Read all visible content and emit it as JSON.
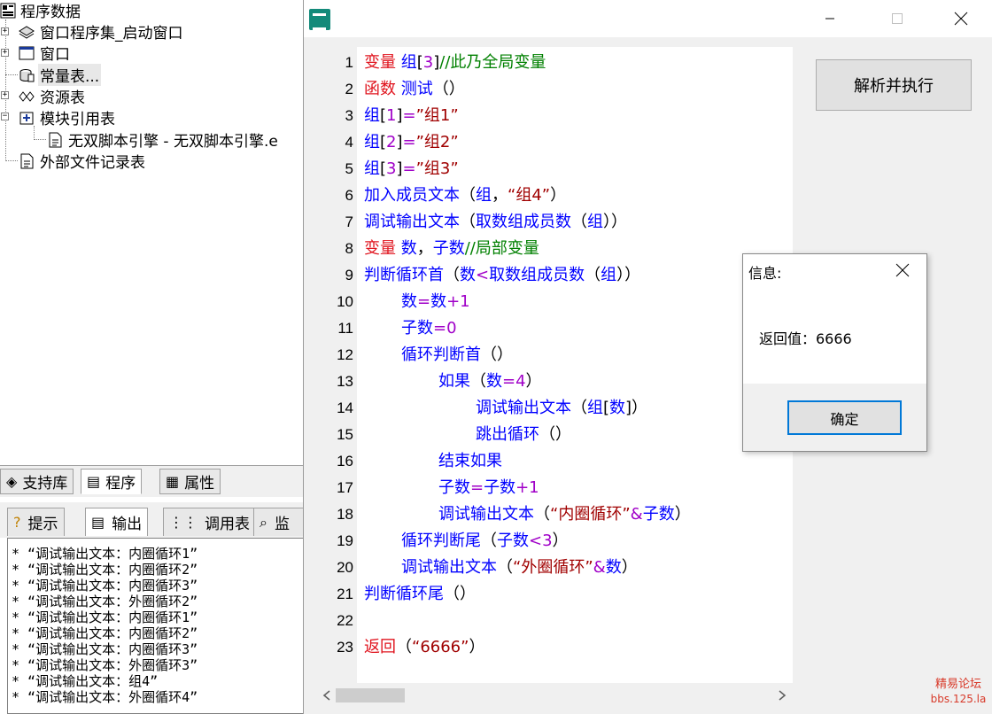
{
  "tree": {
    "root": "程序数据",
    "items": [
      {
        "label": "窗口程序集_启动窗口",
        "icon": "assembly-icon"
      },
      {
        "label": "窗口",
        "icon": "window-icon"
      },
      {
        "label": "常量表...",
        "icon": "constant-table-icon"
      },
      {
        "label": "资源表",
        "icon": "resource-icon"
      },
      {
        "label": "模块引用表",
        "icon": "module-ref-icon"
      },
      {
        "label": "无双脚本引擎 - 无双脚本引擎.e",
        "icon": "document-icon"
      },
      {
        "label": "外部文件记录表",
        "icon": "document-icon"
      }
    ]
  },
  "lower_tabs": [
    {
      "label": "支持库",
      "icon": "library-icon"
    },
    {
      "label": "程序",
      "icon": "program-icon"
    },
    {
      "label": "属性",
      "icon": "property-icon"
    }
  ],
  "output_tabs": [
    {
      "label": "提示",
      "icon": "hint-icon"
    },
    {
      "label": "输出",
      "icon": "output-icon"
    },
    {
      "label": "调用表",
      "icon": "call-table-icon"
    },
    {
      "label": "监",
      "icon": "search-icon"
    }
  ],
  "output_lines": [
    "* “调试输出文本：内圈循环1”",
    "* “调试输出文本：内圈循环2”",
    "* “调试输出文本：内圈循环3”",
    "* “调试输出文本：外圈循环2”",
    "* “调试输出文本：内圈循环1”",
    "* “调试输出文本：内圈循环2”",
    "* “调试输出文本：内圈循环3”",
    "* “调试输出文本：外圈循环3”",
    "* “调试输出文本：组4”",
    "* “调试输出文本：外圈循环4”"
  ],
  "editor": {
    "lines": [
      {
        "n": "1",
        "indent": 0,
        "parts": [
          [
            "kw-red",
            "变量 "
          ],
          [
            "kw-blue",
            "组"
          ],
          [
            "tx-black",
            "["
          ],
          [
            "tx-purple",
            "3"
          ],
          [
            "tx-black",
            "]"
          ],
          [
            "tx-cmt",
            "//此乃全局变量"
          ]
        ]
      },
      {
        "n": "2",
        "indent": 0,
        "parts": [
          [
            "kw-red",
            "函数 "
          ],
          [
            "kw-blue",
            "测试"
          ],
          [
            "tx-black",
            "（）"
          ]
        ]
      },
      {
        "n": "3",
        "indent": 0,
        "parts": [
          [
            "kw-blue",
            "组"
          ],
          [
            "tx-black",
            "["
          ],
          [
            "tx-purple",
            "1"
          ],
          [
            "tx-black",
            "]"
          ],
          [
            "tx-purple",
            "="
          ],
          [
            "tx-str",
            "”组1”"
          ]
        ]
      },
      {
        "n": "4",
        "indent": 0,
        "parts": [
          [
            "kw-blue",
            "组"
          ],
          [
            "tx-black",
            "["
          ],
          [
            "tx-purple",
            "2"
          ],
          [
            "tx-black",
            "]"
          ],
          [
            "tx-purple",
            "="
          ],
          [
            "tx-str",
            "”组2”"
          ]
        ]
      },
      {
        "n": "5",
        "indent": 0,
        "parts": [
          [
            "kw-blue",
            "组"
          ],
          [
            "tx-black",
            "["
          ],
          [
            "tx-purple",
            "3"
          ],
          [
            "tx-black",
            "]"
          ],
          [
            "tx-purple",
            "="
          ],
          [
            "tx-str",
            "”组3”"
          ]
        ]
      },
      {
        "n": "6",
        "indent": 0,
        "parts": [
          [
            "kw-blue",
            "加入成员文本"
          ],
          [
            "tx-black",
            "（"
          ],
          [
            "kw-blue",
            "组"
          ],
          [
            "tx-black",
            "，"
          ],
          [
            "tx-str",
            "“组4”"
          ],
          [
            "tx-black",
            "）"
          ]
        ]
      },
      {
        "n": "7",
        "indent": 0,
        "parts": [
          [
            "kw-blue",
            "调试输出文本"
          ],
          [
            "tx-black",
            "（"
          ],
          [
            "kw-blue",
            "取数组成员数"
          ],
          [
            "tx-black",
            "（"
          ],
          [
            "kw-blue",
            "组"
          ],
          [
            "tx-black",
            "））"
          ]
        ]
      },
      {
        "n": "8",
        "indent": 0,
        "parts": [
          [
            "kw-red",
            "变量 "
          ],
          [
            "kw-blue",
            "数"
          ],
          [
            "tx-black",
            "，"
          ],
          [
            "kw-blue",
            "子数"
          ],
          [
            "tx-cmt",
            "//局部变量"
          ]
        ]
      },
      {
        "n": "9",
        "indent": 0,
        "parts": [
          [
            "kw-blue",
            "判断循环首"
          ],
          [
            "tx-black",
            "（"
          ],
          [
            "kw-blue",
            "数"
          ],
          [
            "tx-purple",
            "<"
          ],
          [
            "kw-blue",
            "取数组成员数"
          ],
          [
            "tx-black",
            "（"
          ],
          [
            "kw-blue",
            "组"
          ],
          [
            "tx-black",
            "））"
          ]
        ]
      },
      {
        "n": "10",
        "indent": 1,
        "parts": [
          [
            "kw-blue",
            "数"
          ],
          [
            "tx-purple",
            "="
          ],
          [
            "kw-blue",
            "数"
          ],
          [
            "tx-purple",
            "+1"
          ]
        ]
      },
      {
        "n": "11",
        "indent": 1,
        "parts": [
          [
            "kw-blue",
            "子数"
          ],
          [
            "tx-purple",
            "=0"
          ]
        ]
      },
      {
        "n": "12",
        "indent": 1,
        "parts": [
          [
            "kw-blue",
            "循环判断首"
          ],
          [
            "tx-black",
            "（）"
          ]
        ]
      },
      {
        "n": "13",
        "indent": 2,
        "parts": [
          [
            "kw-blue",
            "如果"
          ],
          [
            "tx-black",
            "（"
          ],
          [
            "kw-blue",
            "数"
          ],
          [
            "tx-purple",
            "=4"
          ],
          [
            "tx-black",
            "）"
          ]
        ]
      },
      {
        "n": "14",
        "indent": 3,
        "parts": [
          [
            "kw-blue",
            "调试输出文本"
          ],
          [
            "tx-black",
            "（"
          ],
          [
            "kw-blue",
            "组"
          ],
          [
            "tx-black",
            "["
          ],
          [
            "kw-blue",
            "数"
          ],
          [
            "tx-black",
            "]）"
          ]
        ]
      },
      {
        "n": "15",
        "indent": 3,
        "parts": [
          [
            "kw-blue",
            "跳出循环"
          ],
          [
            "tx-black",
            "（）"
          ]
        ]
      },
      {
        "n": "16",
        "indent": 2,
        "parts": [
          [
            "kw-blue",
            "结束如果"
          ]
        ]
      },
      {
        "n": "17",
        "indent": 2,
        "parts": [
          [
            "kw-blue",
            "子数"
          ],
          [
            "tx-purple",
            "="
          ],
          [
            "kw-blue",
            "子数"
          ],
          [
            "tx-purple",
            "+1"
          ]
        ]
      },
      {
        "n": "18",
        "indent": 2,
        "parts": [
          [
            "kw-blue",
            "调试输出文本"
          ],
          [
            "tx-black",
            "（"
          ],
          [
            "tx-str",
            "“内圈循环”"
          ],
          [
            "tx-purple",
            "&"
          ],
          [
            "kw-blue",
            "子数"
          ],
          [
            "tx-black",
            "）"
          ]
        ]
      },
      {
        "n": "19",
        "indent": 1,
        "parts": [
          [
            "kw-blue",
            "循环判断尾"
          ],
          [
            "tx-black",
            "（"
          ],
          [
            "kw-blue",
            "子数"
          ],
          [
            "tx-purple",
            "<3"
          ],
          [
            "tx-black",
            "）"
          ]
        ]
      },
      {
        "n": "20",
        "indent": 1,
        "parts": [
          [
            "kw-blue",
            "调试输出文本"
          ],
          [
            "tx-black",
            "（"
          ],
          [
            "tx-str",
            "“外圈循环”"
          ],
          [
            "tx-purple",
            "&"
          ],
          [
            "kw-blue",
            "数"
          ],
          [
            "tx-black",
            "）"
          ]
        ]
      },
      {
        "n": "21",
        "indent": 0,
        "parts": [
          [
            "kw-blue",
            "判断循环尾"
          ],
          [
            "tx-black",
            "（）"
          ]
        ]
      },
      {
        "n": "22",
        "indent": 0,
        "parts": []
      },
      {
        "n": "23",
        "indent": 0,
        "parts": [
          [
            "kw-red",
            "返回"
          ],
          [
            "tx-black",
            "（"
          ],
          [
            "tx-str",
            "“6666”"
          ],
          [
            "tx-black",
            "）"
          ]
        ]
      }
    ]
  },
  "run_button_label": "解析并执行",
  "msgbox": {
    "title": "信息:",
    "text": "返回值：6666",
    "ok_label": "确定"
  },
  "watermark": {
    "name": "精易论坛",
    "url": "bbs.125.la"
  },
  "colors": {
    "keyword_red": "#e0141e",
    "identifier_blue": "#0000ff",
    "number_purple": "#a000c8",
    "string_darkred": "#a00000",
    "comment_green": "#008000",
    "focus_blue": "#0078d7",
    "app_icon_teal": "#138a7a"
  }
}
